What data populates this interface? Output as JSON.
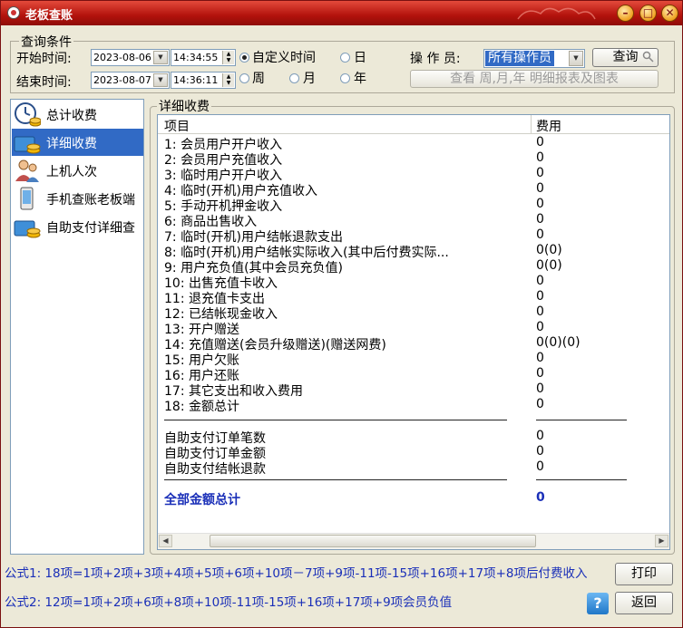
{
  "window": {
    "title": "老板查账"
  },
  "query": {
    "group_label": "查询条件",
    "start_label": "开始时间:",
    "end_label": "结束时间:",
    "start_date": "2023-08-06",
    "start_time": "14:34:55",
    "end_date": "2023-08-07",
    "end_time": "14:36:11",
    "radios": [
      {
        "label": "自定义时间",
        "checked": true
      },
      {
        "label": "日",
        "checked": false
      },
      {
        "label": "周",
        "checked": false
      },
      {
        "label": "月",
        "checked": false
      },
      {
        "label": "年",
        "checked": false
      }
    ],
    "operator_label": "操 作 员:",
    "operator_value": "所有操作员",
    "search_button": "查询",
    "report_button": "查看 周,月,年 明细报表及图表"
  },
  "sidebar": {
    "items": [
      {
        "label": "总计收费",
        "icon": "clock-coins-icon"
      },
      {
        "label": "详细收费",
        "icon": "coins-user-icon",
        "selected": true
      },
      {
        "label": "上机人次",
        "icon": "users-icon"
      },
      {
        "label": "手机查账老板端",
        "icon": "phone-icon"
      },
      {
        "label": "自助支付详细查",
        "icon": "wallet-coins-icon"
      }
    ]
  },
  "detail": {
    "group_label": "详细收费",
    "col_item": "项目",
    "col_fee": "费用",
    "rows": [
      {
        "item": "1: 会员用户开户收入",
        "fee": "0"
      },
      {
        "item": "2: 会员用户充值收入",
        "fee": "0"
      },
      {
        "item": "3: 临时用户开户收入",
        "fee": "0"
      },
      {
        "item": "4: 临时(开机)用户充值收入",
        "fee": "0"
      },
      {
        "item": "5: 手动开机押金收入",
        "fee": "0"
      },
      {
        "item": "6: 商品出售收入",
        "fee": "0"
      },
      {
        "item": "7: 临时(开机)用户结帐退款支出",
        "fee": "0"
      },
      {
        "item": "8: 临时(开机)用户结帐实际收入(其中后付费实际...",
        "fee": "0(0)"
      },
      {
        "item": "9: 用户充负值(其中会员充负值)",
        "fee": "0(0)"
      },
      {
        "item": "10: 出售充值卡收入",
        "fee": "0"
      },
      {
        "item": "11: 退充值卡支出",
        "fee": "0"
      },
      {
        "item": "12: 已结帐现金收入",
        "fee": "0"
      },
      {
        "item": "13: 开户赠送",
        "fee": "0"
      },
      {
        "item": "14: 充值赠送(会员升级赠送)(赠送网费)",
        "fee": "0(0)(0)"
      },
      {
        "item": "15: 用户欠账",
        "fee": "0"
      },
      {
        "item": "16: 用户还账",
        "fee": "0"
      },
      {
        "item": "17: 其它支出和收入费用",
        "fee": "0"
      },
      {
        "item": "18: 金额总计",
        "fee": "0"
      }
    ],
    "self_rows": [
      {
        "item": "自助支付订单笔数",
        "fee": "0"
      },
      {
        "item": "自助支付订单金额",
        "fee": "0"
      },
      {
        "item": "自助支付结帐退款",
        "fee": "0"
      }
    ],
    "grand_total": {
      "item": "全部金额总计",
      "fee": "0"
    }
  },
  "footer": {
    "formula1": "公式1: 18项=1项+2项+3项+4项+5项+6项+10项－7项+9项-11项-15项+16项+17项+8项后付费收入",
    "formula2": "公式2: 12项=1项+2项+6项+8项+10项-11项-15项+16项+17项+9项会员负值",
    "print_button": "打印",
    "back_button": "返回"
  }
}
